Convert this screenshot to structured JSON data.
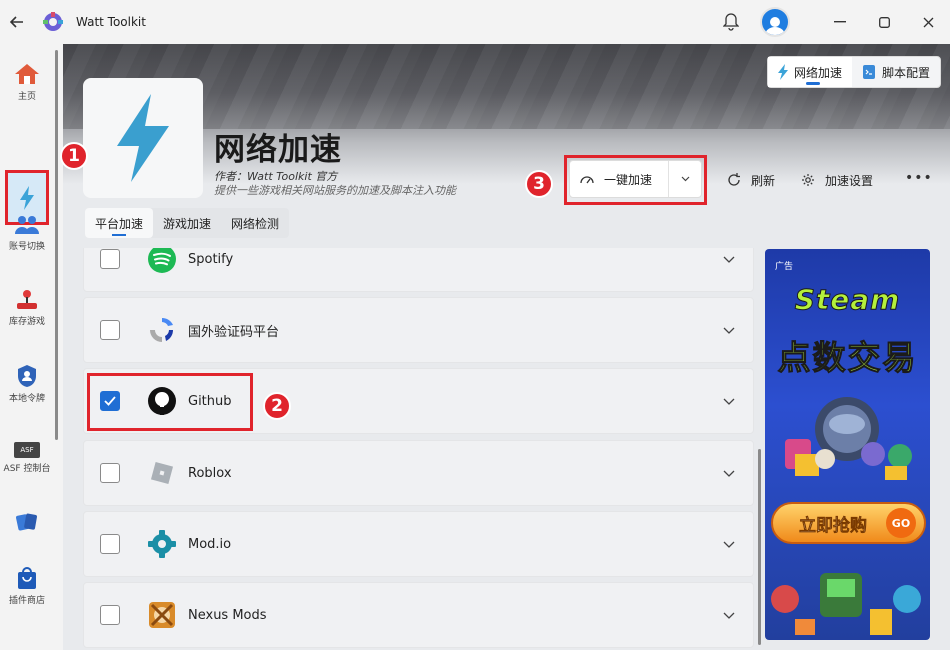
{
  "window": {
    "title": "Watt Toolkit"
  },
  "sidebar": {
    "items": [
      {
        "label": "主页",
        "icon": "home-icon"
      },
      {
        "label": "",
        "icon": "lightning-icon"
      },
      {
        "label": "账号切换",
        "icon": "users-icon"
      },
      {
        "label": "库存游戏",
        "icon": "joystick-icon"
      },
      {
        "label": "本地令牌",
        "icon": "shield-icon"
      },
      {
        "label": "ASF 控制台",
        "icon": "asf-icon"
      },
      {
        "label": "",
        "icon": "cards-icon"
      },
      {
        "label": "插件商店",
        "icon": "shop-bag-icon"
      }
    ],
    "asf_badge": "ASF"
  },
  "top_tabs": [
    {
      "label": "网络加速",
      "active": true
    },
    {
      "label": "脚本配置",
      "active": false
    }
  ],
  "header": {
    "title": "网络加速",
    "author": "作者：Watt Toolkit 官方",
    "description": "提供一些游戏相关网站服务的加速及脚本注入功能"
  },
  "actions": {
    "accelerate": "一键加速",
    "refresh": "刷新",
    "settings": "加速设置",
    "more": "•••"
  },
  "sub_tabs": [
    {
      "label": "平台加速",
      "active": true
    },
    {
      "label": "游戏加速",
      "active": false
    },
    {
      "label": "网络检测",
      "active": false
    }
  ],
  "services": [
    {
      "name": "Spotify",
      "checked": false,
      "icon": "spotify-icon"
    },
    {
      "name": "国外验证码平台",
      "checked": false,
      "icon": "recaptcha-icon"
    },
    {
      "name": "Github",
      "checked": true,
      "icon": "github-icon"
    },
    {
      "name": "Roblox",
      "checked": false,
      "icon": "roblox-icon"
    },
    {
      "name": "Mod.io",
      "checked": false,
      "icon": "modio-icon"
    },
    {
      "name": "Nexus Mods",
      "checked": false,
      "icon": "nexus-icon"
    }
  ],
  "ad": {
    "label": "广告",
    "headline": "Steam",
    "subheadline": "点数交易",
    "button": "立即抢购",
    "go": "GO"
  },
  "callouts": [
    "1",
    "2",
    "3"
  ],
  "colors": {
    "accent": "#1f6ed4",
    "highlight": "#e0242c",
    "lightning": "#3aa3d8"
  }
}
